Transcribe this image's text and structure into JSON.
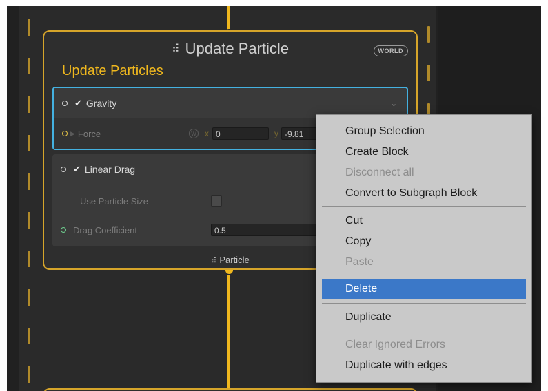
{
  "node": {
    "title_icon": "particle-system-icon",
    "title": "Update Particle",
    "space_badge": "WORLD",
    "context_label": "Update Particles",
    "footer_icon": "particle-icon",
    "footer_label": "Particle"
  },
  "gravity_block": {
    "checked": "✔",
    "label": "Gravity",
    "force_label": "Force",
    "space_badge": "W",
    "x_label": "x",
    "x_value": "0",
    "y_label": "y",
    "y_value": "-9.81"
  },
  "drag_block": {
    "checked": "✔",
    "label": "Linear Drag",
    "use_size_label": "Use Particle Size",
    "coef_label": "Drag Coefficient",
    "coef_value": "0.5"
  },
  "context_menu": {
    "items": [
      {
        "label": "Group Selection",
        "enabled": true
      },
      {
        "label": "Create Block",
        "enabled": true
      },
      {
        "label": "Disconnect all",
        "enabled": false
      },
      {
        "label": "Convert to Subgraph Block",
        "enabled": true
      },
      {
        "label": "Cut",
        "enabled": true
      },
      {
        "label": "Copy",
        "enabled": true
      },
      {
        "label": "Paste",
        "enabled": false
      },
      {
        "label": "Delete",
        "enabled": true,
        "highlighted": true
      },
      {
        "label": "Duplicate",
        "enabled": true
      },
      {
        "label": "Clear Ignored Errors",
        "enabled": false
      },
      {
        "label": "Duplicate with edges",
        "enabled": true
      }
    ]
  },
  "colors": {
    "accent_yellow": "#f0b81e",
    "selection_blue": "#44b1e0",
    "menu_highlight": "#3b78c8"
  }
}
